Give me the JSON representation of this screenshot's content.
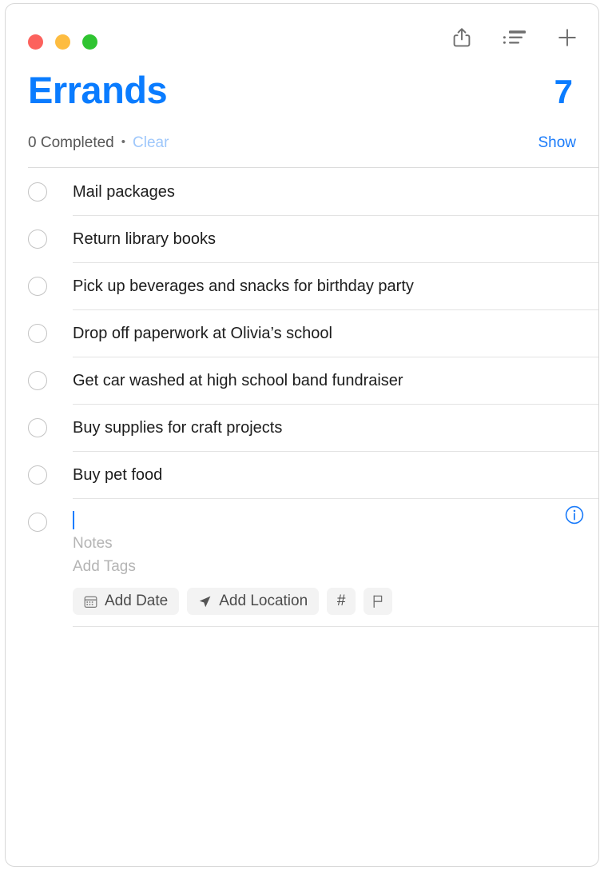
{
  "window": {
    "traffic_lights": [
      {
        "name": "close",
        "color": "#fc625d"
      },
      {
        "name": "minimize",
        "color": "#fdbc40"
      },
      {
        "name": "maximize",
        "color": "#2fc431"
      }
    ]
  },
  "toolbar": {
    "actions": [
      {
        "name": "share-icon",
        "label": "Share"
      },
      {
        "name": "list-view-icon",
        "label": "View as List"
      },
      {
        "name": "plus-icon",
        "label": "Add Reminder"
      }
    ]
  },
  "header": {
    "title": "Errands",
    "count": "7",
    "completed_label": "0 Completed",
    "separator_dot": "•",
    "clear_label": "Clear",
    "show_label": "Show",
    "accent_color": "#0a7cff",
    "clear_color": "#9ec7fb",
    "show_color": "#1a7bfa"
  },
  "list": {
    "items": [
      {
        "text": "Mail packages",
        "completed": false
      },
      {
        "text": "Return library books",
        "completed": false
      },
      {
        "text": "Pick up beverages and snacks for birthday party",
        "completed": false
      },
      {
        "text": "Drop off paperwork at Olivia’s school",
        "completed": false
      },
      {
        "text": "Get car washed at high school band fundraiser",
        "completed": false
      },
      {
        "text": "Buy supplies for craft projects",
        "completed": false
      },
      {
        "text": "Buy pet food",
        "completed": false
      }
    ]
  },
  "new_item": {
    "title_value": "",
    "notes_placeholder": "Notes",
    "tags_placeholder": "Add Tags",
    "info_icon": "info-circle-icon",
    "chips": [
      {
        "name": "add-date",
        "icon": "calendar-icon",
        "label": "Add Date"
      },
      {
        "name": "add-location",
        "icon": "location-arrow-icon",
        "label": "Add Location"
      },
      {
        "name": "add-tag",
        "icon": "hash-icon",
        "label": "#"
      },
      {
        "name": "add-flag",
        "icon": "flag-icon",
        "label": ""
      }
    ]
  }
}
